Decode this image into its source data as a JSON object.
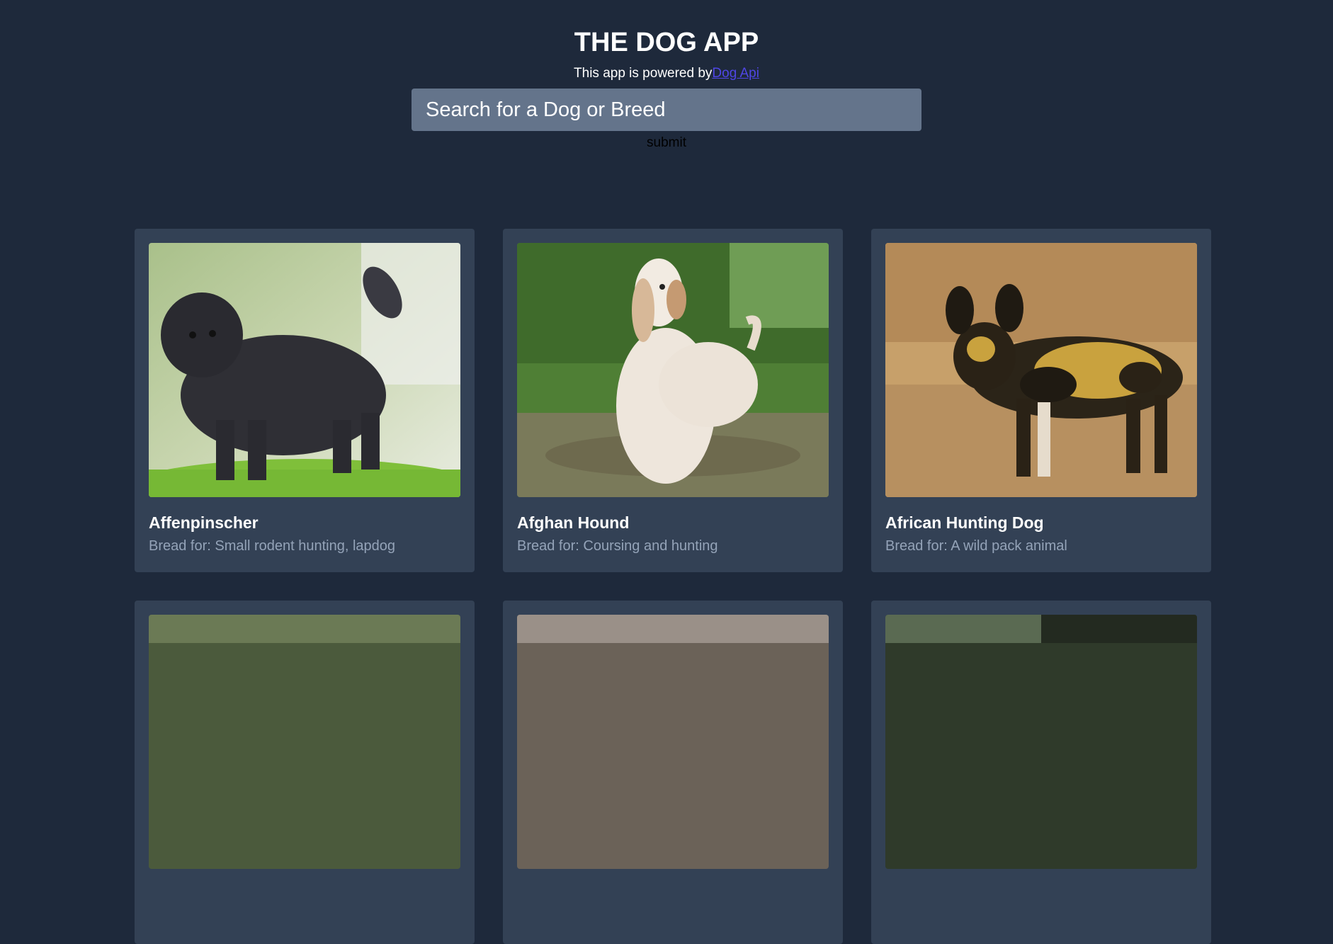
{
  "header": {
    "title": "THE DOG APP",
    "powered_prefix": "This app is powered by",
    "powered_link": "Dog Api"
  },
  "search": {
    "placeholder": "Search for a Dog or Breed",
    "submit_label": "submit"
  },
  "cards": [
    {
      "name": "Affenpinscher",
      "bred_for": "Bread for: Small rodent hunting, lapdog",
      "image_icon": "dog-photo-affenpinscher"
    },
    {
      "name": "Afghan Hound",
      "bred_for": "Bread for: Coursing and hunting",
      "image_icon": "dog-photo-afghan-hound"
    },
    {
      "name": "African Hunting Dog",
      "bred_for": "Bread for: A wild pack animal",
      "image_icon": "dog-photo-african-hunting-dog"
    }
  ],
  "colors": {
    "background": "#1e293b",
    "card": "#334155",
    "input": "#64748b",
    "link": "#4f46e5",
    "muted_text": "#94a3b8"
  }
}
